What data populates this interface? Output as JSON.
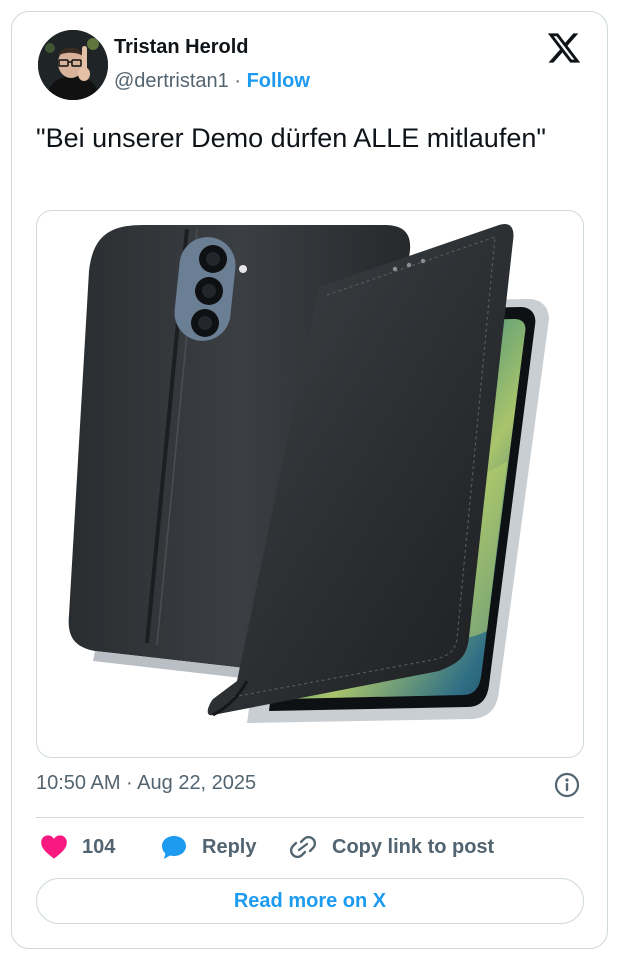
{
  "author": {
    "name": "Tristan Herold",
    "handle": "@dertristan1",
    "separator": "·",
    "follow_label": "Follow",
    "avatar_icon": "user-avatar"
  },
  "brand": {
    "logo_icon": "x-logo-icon"
  },
  "tweet": {
    "text": "\"Bei unserer Demo dürfen ALLE mitlaufen\"",
    "media_description_icon": "phone-flip-case-image"
  },
  "meta": {
    "timestamp": "10:50 AM · Aug 22, 2025",
    "info_icon": "info-icon"
  },
  "actions": {
    "likes": "104",
    "reply_label": "Reply",
    "copy_label": "Copy link to post"
  },
  "footer": {
    "read_more_label": "Read more on X"
  },
  "colors": {
    "accent": "#1d9bf0",
    "like": "#f91880",
    "text": "#0f1419",
    "muted": "#536471",
    "border": "#cfd9de"
  }
}
